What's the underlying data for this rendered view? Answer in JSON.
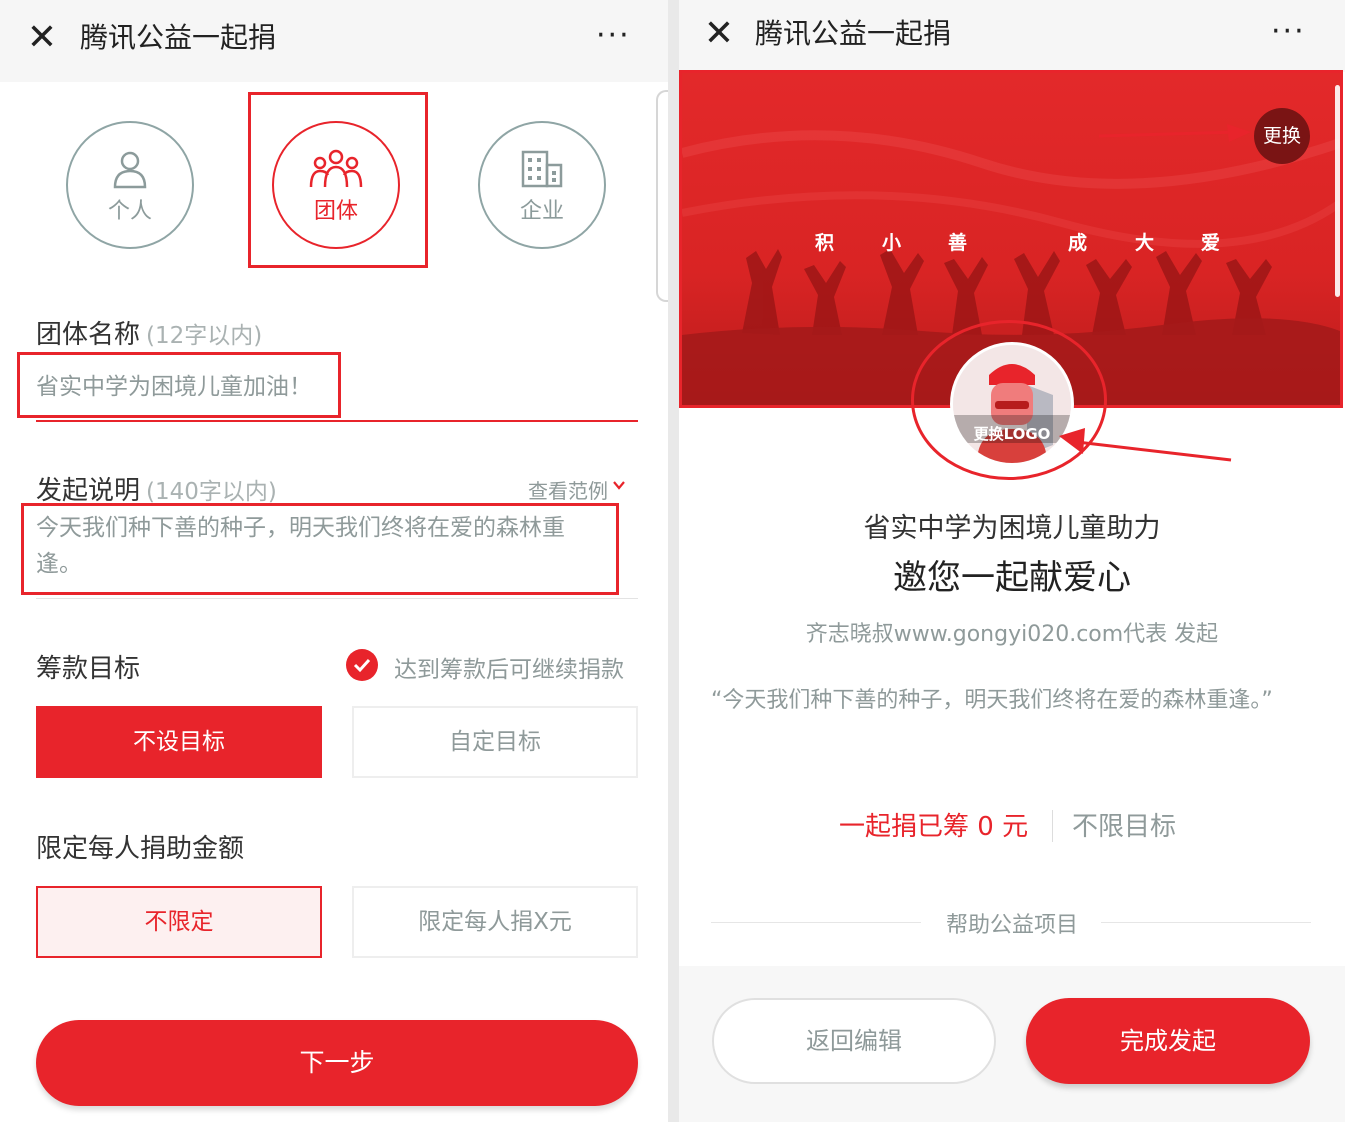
{
  "left": {
    "header": {
      "title": "腾讯公益一起捐",
      "more": "···"
    },
    "types": [
      {
        "label": "个人",
        "icon": "person-icon"
      },
      {
        "label": "团体",
        "icon": "group-icon",
        "selected": true
      },
      {
        "label": "企业",
        "icon": "building-icon"
      }
    ],
    "group_name": {
      "label": "团体名称",
      "hint": "(12字以内)",
      "value": "省实中学为困境儿童加油！"
    },
    "description": {
      "label": "发起说明",
      "hint": "(140字以内)",
      "example_link": "查看范例",
      "value": "今天我们种下善的种子，明天我们终将在爱的森林重逢。"
    },
    "goal": {
      "label": "筹款目标",
      "continue_label": "达到筹款后可继续捐款",
      "continue_checked": true,
      "options": [
        "不设目标",
        "自定目标"
      ],
      "selected": "不设目标"
    },
    "limit": {
      "label": "限定每人捐助金额",
      "options": [
        "不限定",
        "限定每人捐X元"
      ],
      "selected": "不限定"
    },
    "next_label": "下一步"
  },
  "right": {
    "header": {
      "title": "腾讯公益一起捐",
      "more": "···"
    },
    "banner": {
      "change_label": "更换",
      "slogan_chars": [
        "积",
        "小",
        "善",
        "成",
        "大",
        "爱"
      ]
    },
    "logo_label": "更换LOGO",
    "project_title": "省实中学为困境儿童助力",
    "subtitle": "邀您一起献爱心",
    "initiator": "齐志晓叔www.gongyi020.com代表 发起",
    "quote": "“今天我们种下善的种子，明天我们终将在爱的森林重逢。”",
    "raised": "一起捐已筹 0 元",
    "target": "不限目标",
    "help_label": "帮助公益项目",
    "back_label": "返回编辑",
    "done_label": "完成发起"
  },
  "colors": {
    "accent": "#e8242b",
    "muted": "#8f9a9a",
    "dark_red": "#7a1414"
  }
}
